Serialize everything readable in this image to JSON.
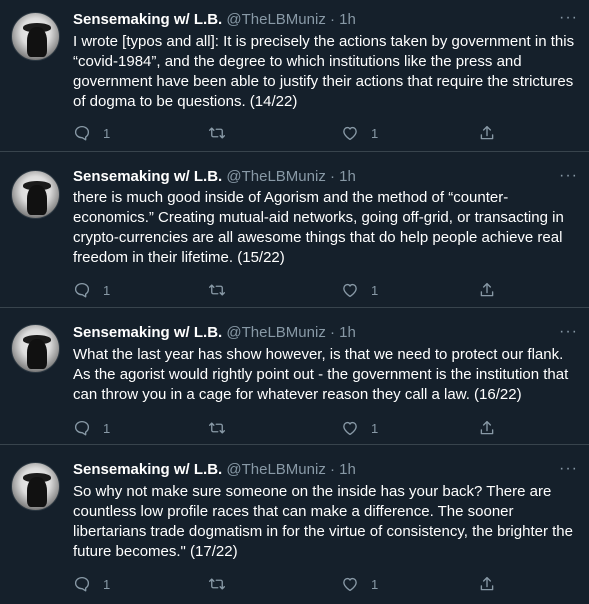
{
  "tweets": [
    {
      "name": "Sensemaking w/ L.B.",
      "handle": "@TheLBMuniz",
      "dot": "·",
      "time": "1h",
      "text": "I wrote [typos and all]: It is precisely the actions taken by government in this “covid-1984”, and the degree to which institutions like the press and government have been able to justify their actions that require the strictures of dogma to be questions. (14/22)",
      "reply_count": "1",
      "like_count": "1"
    },
    {
      "name": "Sensemaking w/ L.B.",
      "handle": "@TheLBMuniz",
      "dot": "·",
      "time": "1h",
      "text": "there is much good inside of Agorism and the method of “counter-economics.” Creating mutual-aid networks, going off-grid, or transacting in crypto-currencies are all awesome things that do help people achieve real freedom in their lifetime. (15/22)",
      "reply_count": "1",
      "like_count": "1"
    },
    {
      "name": "Sensemaking w/ L.B.",
      "handle": "@TheLBMuniz",
      "dot": "·",
      "time": "1h",
      "text": "What the last year has show however, is that we need to protect our flank. As the agorist would rightly point out - the government is the institution that can throw you in a cage for whatever reason they call a law. (16/22)",
      "reply_count": "1",
      "like_count": "1"
    },
    {
      "name": "Sensemaking w/ L.B.",
      "handle": "@TheLBMuniz",
      "dot": "·",
      "time": "1h",
      "text": "So why not make sure someone on the inside has your back? There are countless low profile races that can make a difference. The sooner libertarians trade dogmatism in for the virtue of consistency, the brighter the future becomes.\" (17/22)",
      "reply_count": "1",
      "like_count": "1"
    }
  ],
  "icons": {
    "reply": "speech-bubble-icon",
    "retweet": "retweet-arrows-icon",
    "like": "heart-icon",
    "share": "share-upload-icon",
    "more": "more-dots-icon"
  },
  "colors": {
    "background": "#15202b",
    "secondary_text": "#8899a6",
    "divider": "#38444d"
  }
}
